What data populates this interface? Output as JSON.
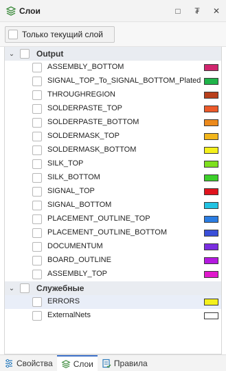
{
  "panel": {
    "title": "Слои",
    "actions": [
      {
        "name": "maximize",
        "glyph": "□"
      },
      {
        "name": "pin",
        "glyph": "₮"
      },
      {
        "name": "close",
        "glyph": "✕"
      }
    ]
  },
  "toolbar": {
    "only_current_label": "Только текущий слой"
  },
  "groups": [
    {
      "name": "Output",
      "items": [
        {
          "name": "ASSEMBLY_BOTTOM",
          "color": "#d0266e"
        },
        {
          "name": "SIGNAL_TOP_To_SIGNAL_BOTTOM_Plated",
          "color": "#20b44a"
        },
        {
          "name": "THROUGHREGION",
          "color": "#b8401c"
        },
        {
          "name": "SOLDERPASTE_TOP",
          "color": "#ec5a2a"
        },
        {
          "name": "SOLDERPASTE_BOTTOM",
          "color": "#ec8a1c"
        },
        {
          "name": "SOLDERMASK_TOP",
          "color": "#f2b61c"
        },
        {
          "name": "SOLDERMASK_BOTTOM",
          "color": "#f4f01c"
        },
        {
          "name": "SILK_TOP",
          "color": "#7ee01e"
        },
        {
          "name": "SILK_BOTTOM",
          "color": "#3ccf2a"
        },
        {
          "name": "SIGNAL_TOP",
          "color": "#e0131d"
        },
        {
          "name": "SIGNAL_BOTTOM",
          "color": "#22c2e2"
        },
        {
          "name": "PLACEMENT_OUTLINE_TOP",
          "color": "#2b7de2"
        },
        {
          "name": "PLACEMENT_OUTLINE_BOTTOM",
          "color": "#3a4fd8"
        },
        {
          "name": "DOCUMENTUM",
          "color": "#7a2ee0"
        },
        {
          "name": "BOARD_OUTLINE",
          "color": "#b419e0"
        },
        {
          "name": "ASSEMBLY_TOP",
          "color": "#e019cc"
        }
      ]
    },
    {
      "name": "Служебные",
      "items": [
        {
          "name": "ERRORS",
          "color": "#f4f01c",
          "selected": true
        },
        {
          "name": "ExternalNets",
          "color": "#ffffff"
        }
      ]
    }
  ],
  "bottom_tabs": [
    {
      "label": "Свойства",
      "icon": "sliders-icon",
      "active": false
    },
    {
      "label": "Слои",
      "icon": "layers-icon",
      "active": true
    },
    {
      "label": "Правила",
      "icon": "rules-icon",
      "active": false
    }
  ],
  "colors": {
    "accent": "#3a6ec7",
    "group_bg": "#e9ecf1",
    "selected_bg": "#e9eef8"
  }
}
